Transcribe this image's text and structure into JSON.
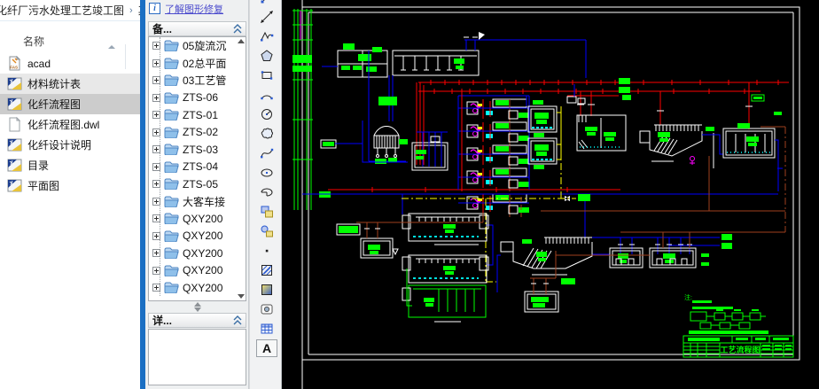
{
  "explorer": {
    "breadcrumb": {
      "path": "化纤厂污水处理工艺竣工图",
      "separator": "›",
      "next": "其"
    },
    "column_header": "名称",
    "fas_label": "FAS",
    "files": [
      {
        "name": "acad",
        "icon": "fas-file",
        "state": "normal"
      },
      {
        "name": "材料统计表",
        "icon": "dwg-file",
        "state": "hover"
      },
      {
        "name": "化纤流程图",
        "icon": "dwg-file",
        "state": "selected"
      },
      {
        "name": "化纤流程图.dwl",
        "icon": "plain-file",
        "state": "normal"
      },
      {
        "name": "化纤设计说明",
        "icon": "dwg-file",
        "state": "normal"
      },
      {
        "name": "目录",
        "icon": "dwg-file",
        "state": "normal"
      },
      {
        "name": "平面图",
        "icon": "dwg-file",
        "state": "normal"
      }
    ]
  },
  "recovery_panel": {
    "help_link": "了解图形修复",
    "backup_header": "备...",
    "details_header": "详...",
    "tree_items": [
      "05旋流沉",
      "02总平面",
      "03工艺管",
      "ZTS-06",
      "ZTS-01",
      "ZTS-02",
      "ZTS-03",
      "ZTS-04",
      "ZTS-05",
      "大客车接",
      "QXY200",
      "QXY200",
      "QXY200",
      "QXY200",
      "QXY200"
    ]
  },
  "draw_toolbar": {
    "text_icon_label": "A",
    "icons": [
      "line",
      "construction-line",
      "polyline",
      "polygon",
      "rectangle",
      "arc",
      "circle",
      "revision-cloud",
      "spline",
      "ellipse",
      "ellipse-arc",
      "insert-block",
      "make-block",
      "point",
      "hatch",
      "gradient",
      "region",
      "table",
      "multiline-text"
    ]
  },
  "canvas": {
    "title_block_title": "工艺流程图",
    "notes_label": "注:",
    "colors": {
      "pipe_red": "#ff0000",
      "pipe_blue": "#0000ff",
      "label_green": "#00ff00",
      "diffuser_cyan": "#00ffff",
      "pump_magenta": "#ff00ff",
      "sludge_brown": "#a0401e",
      "line_yellow": "#ffff00",
      "structure_white": "#ffffff"
    }
  }
}
